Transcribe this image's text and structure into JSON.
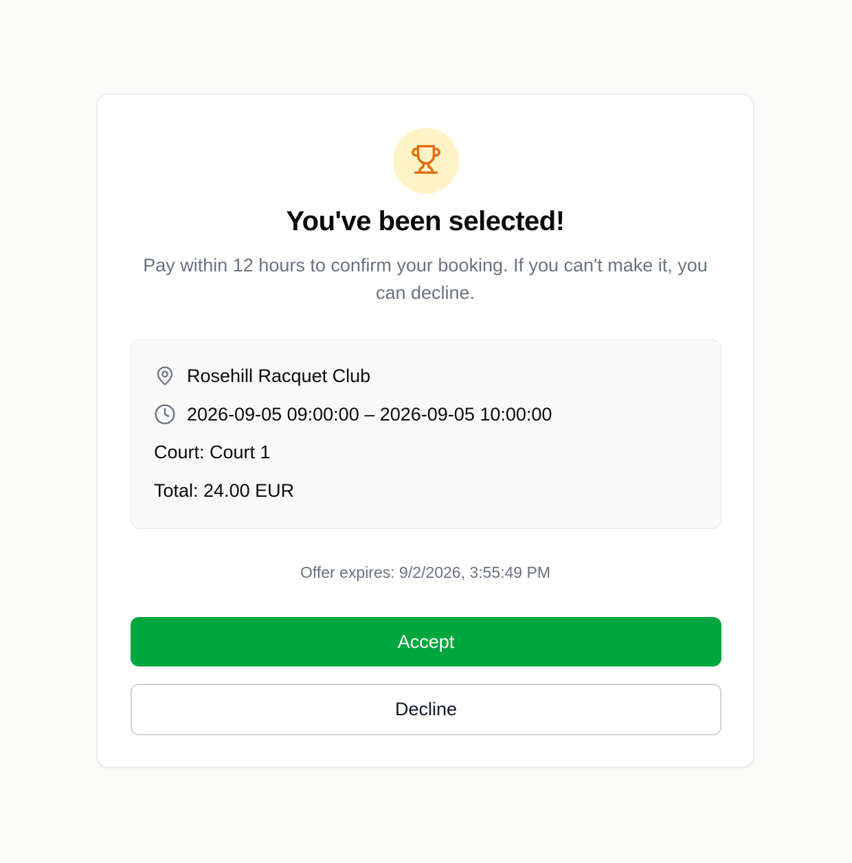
{
  "offer": {
    "title": "You've been selected!",
    "subtitle": "Pay within 12 hours to confirm your booking. If you can't make it, you can decline.",
    "icon": "trophy-icon",
    "details": {
      "location": "Rosehill Racquet Club",
      "time_range": "2026-09-05 09:00:00 – 2026-09-05 10:00:00",
      "court": "Court: Court 1",
      "total": "Total: 24.00 EUR"
    },
    "expires": "Offer expires: 9/2/2026, 3:55:49 PM",
    "accept_label": "Accept",
    "decline_label": "Decline"
  },
  "colors": {
    "page_background": "#fafaf9",
    "trophy_circle": "#fef3c7",
    "trophy": "#e06c00",
    "accept": "#00a63e",
    "muted_text": "#6b7280"
  }
}
